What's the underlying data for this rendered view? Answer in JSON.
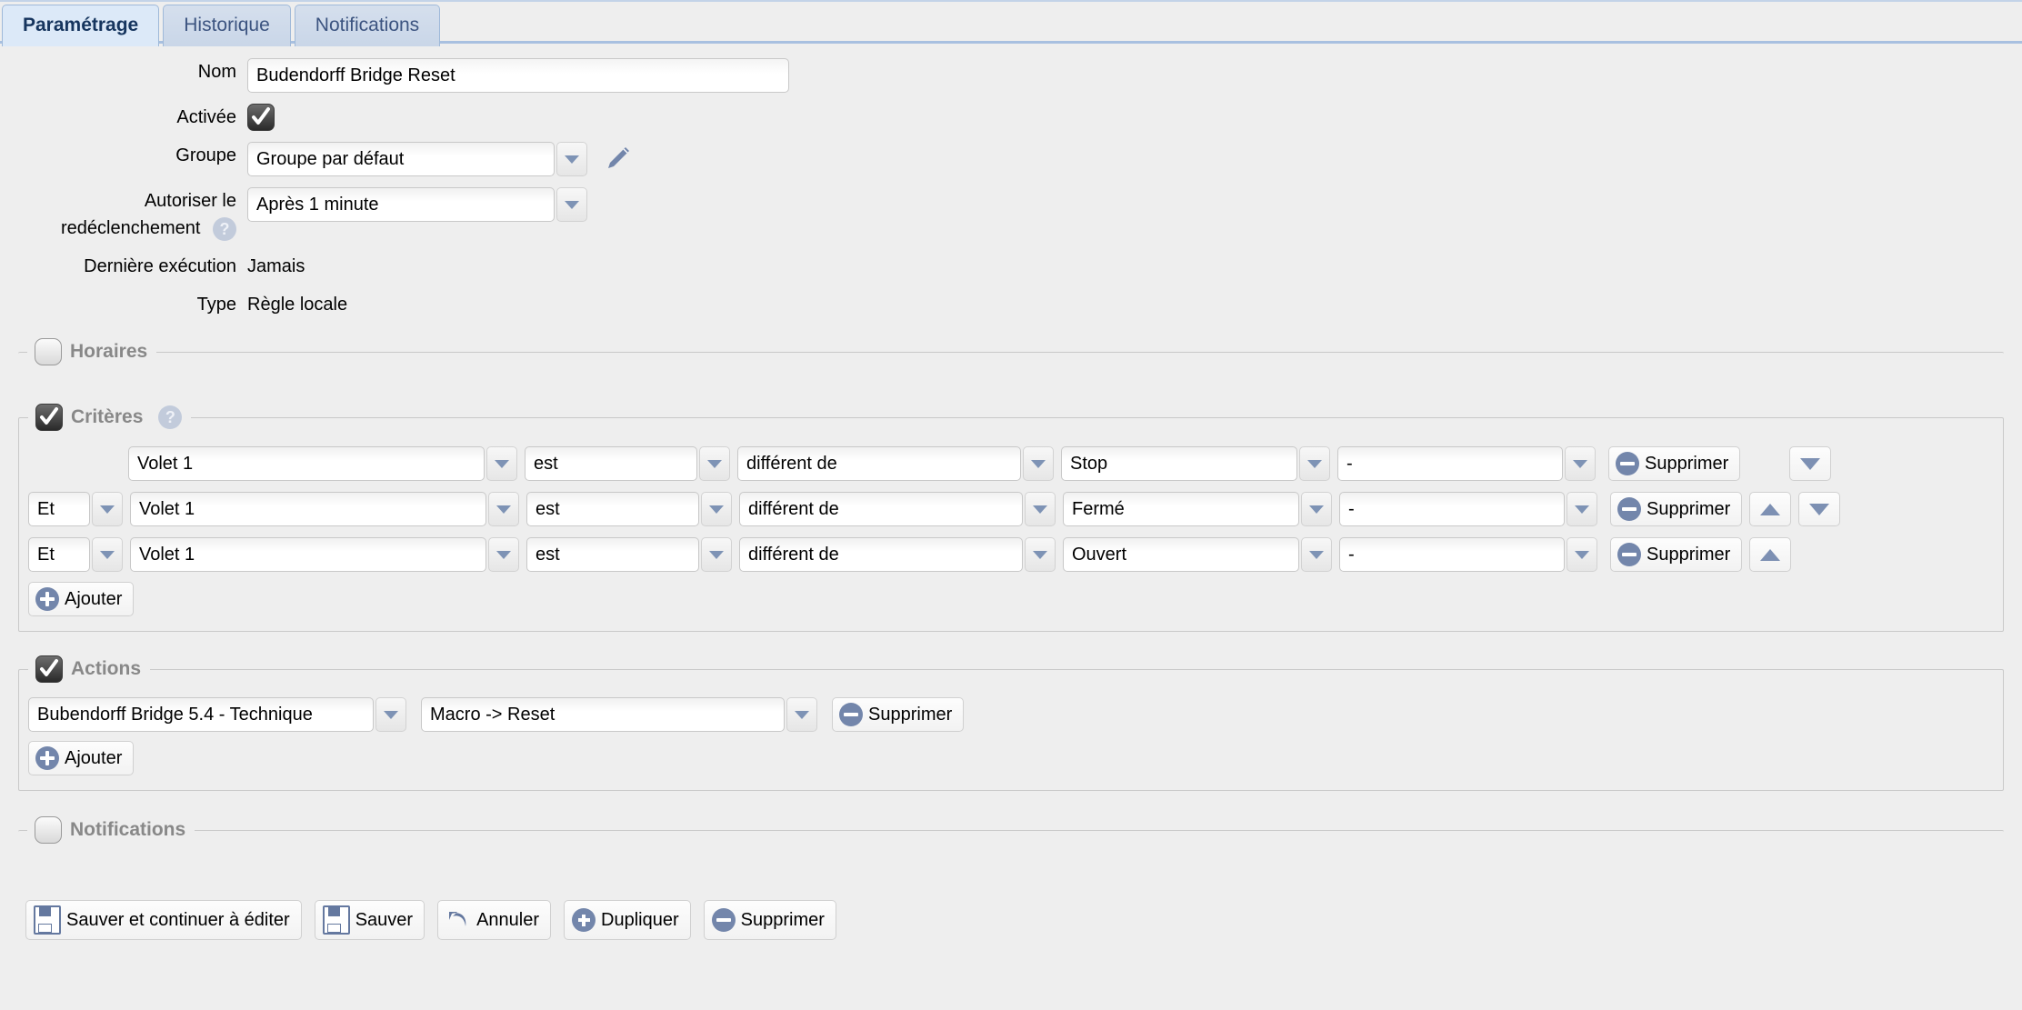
{
  "tabs": [
    {
      "label": "Paramétrage",
      "active": true
    },
    {
      "label": "Historique",
      "active": false
    },
    {
      "label": "Notifications",
      "active": false
    }
  ],
  "form": {
    "name_label": "Nom",
    "name_value": "Budendorff Bridge Reset",
    "enabled_label": "Activée",
    "enabled_checked": true,
    "group_label": "Groupe",
    "group_value": "Groupe par défaut",
    "retrigger_label_line1": "Autoriser le",
    "retrigger_label_line2": "redéclenchement",
    "retrigger_value": "Après 1 minute",
    "help_glyph": "?",
    "last_run_label": "Dernière exécution",
    "last_run_value": "Jamais",
    "type_label": "Type",
    "type_value": "Règle locale"
  },
  "schedule": {
    "legend": "Horaires",
    "checked": false
  },
  "criteria": {
    "legend": "Critères",
    "checked": true,
    "help_glyph": "?",
    "add_label": "Ajouter",
    "delete_label": "Supprimer",
    "rows": [
      {
        "conjunction": "",
        "device": "Volet 1",
        "verb": "est",
        "operator": "différent de",
        "value": "Stop",
        "extra": "-",
        "has_up": false,
        "has_down": true
      },
      {
        "conjunction": "Et",
        "device": "Volet 1",
        "verb": "est",
        "operator": "différent de",
        "value": "Fermé",
        "extra": "-",
        "has_up": true,
        "has_down": true
      },
      {
        "conjunction": "Et",
        "device": "Volet 1",
        "verb": "est",
        "operator": "différent de",
        "value": "Ouvert",
        "extra": "-",
        "has_up": true,
        "has_down": false
      }
    ]
  },
  "actions": {
    "legend": "Actions",
    "checked": true,
    "add_label": "Ajouter",
    "delete_label": "Supprimer",
    "rows": [
      {
        "device": "Bubendorff Bridge 5.4 - Technique",
        "command": "Macro -> Reset"
      }
    ]
  },
  "notifications": {
    "legend": "Notifications",
    "checked": false
  },
  "footer": {
    "save_continue_label": "Sauver et continuer à éditer",
    "save_label": "Sauver",
    "cancel_label": "Annuler",
    "duplicate_label": "Dupliquer",
    "delete_label": "Supprimer"
  },
  "colors": {
    "page_bg": "#eeeeee",
    "tab_active_bg": "#dce9f8",
    "tab_inactive_bg": "#cdd9ea",
    "tab_border": "#9fb9d9",
    "accent_blue": "#7386ab",
    "legend_text": "#888888"
  }
}
